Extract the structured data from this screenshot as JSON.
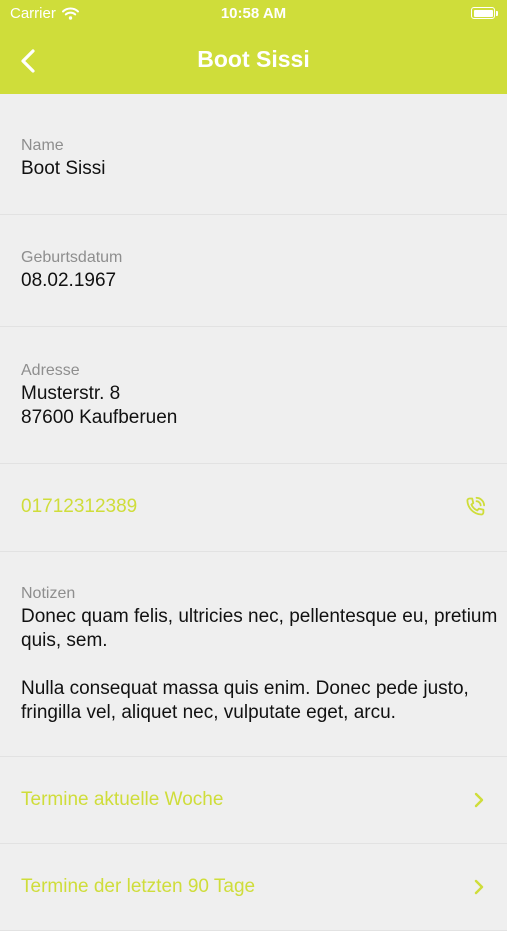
{
  "status_bar": {
    "carrier": "Carrier",
    "time": "10:58 AM"
  },
  "nav": {
    "title": "Boot Sissi",
    "back_icon": "chevron-left-icon"
  },
  "fields": {
    "name": {
      "label": "Name",
      "value": "Boot Sissi"
    },
    "birthdate": {
      "label": "Geburtsdatum",
      "value": "08.02.1967"
    },
    "address": {
      "label": "Adresse",
      "line1": "Musterstr. 8",
      "line2": "87600 Kaufberuen"
    },
    "phone": {
      "value": "01712312389",
      "icon": "phone-call-icon"
    },
    "notes": {
      "label": "Notizen",
      "paragraph1": "Donec quam felis, ultricies nec, pellentesque eu, pretium quis, sem.",
      "paragraph2": "Nulla consequat massa quis enim. Donec pede justo, fringilla vel, aliquet nec, vulputate eget, arcu."
    }
  },
  "links": {
    "current_week": "Termine aktuelle Woche",
    "last_90_days": "Termine der letzten 90 Tage"
  },
  "colors": {
    "accent": "#cfdd3a",
    "background": "#efefef"
  }
}
